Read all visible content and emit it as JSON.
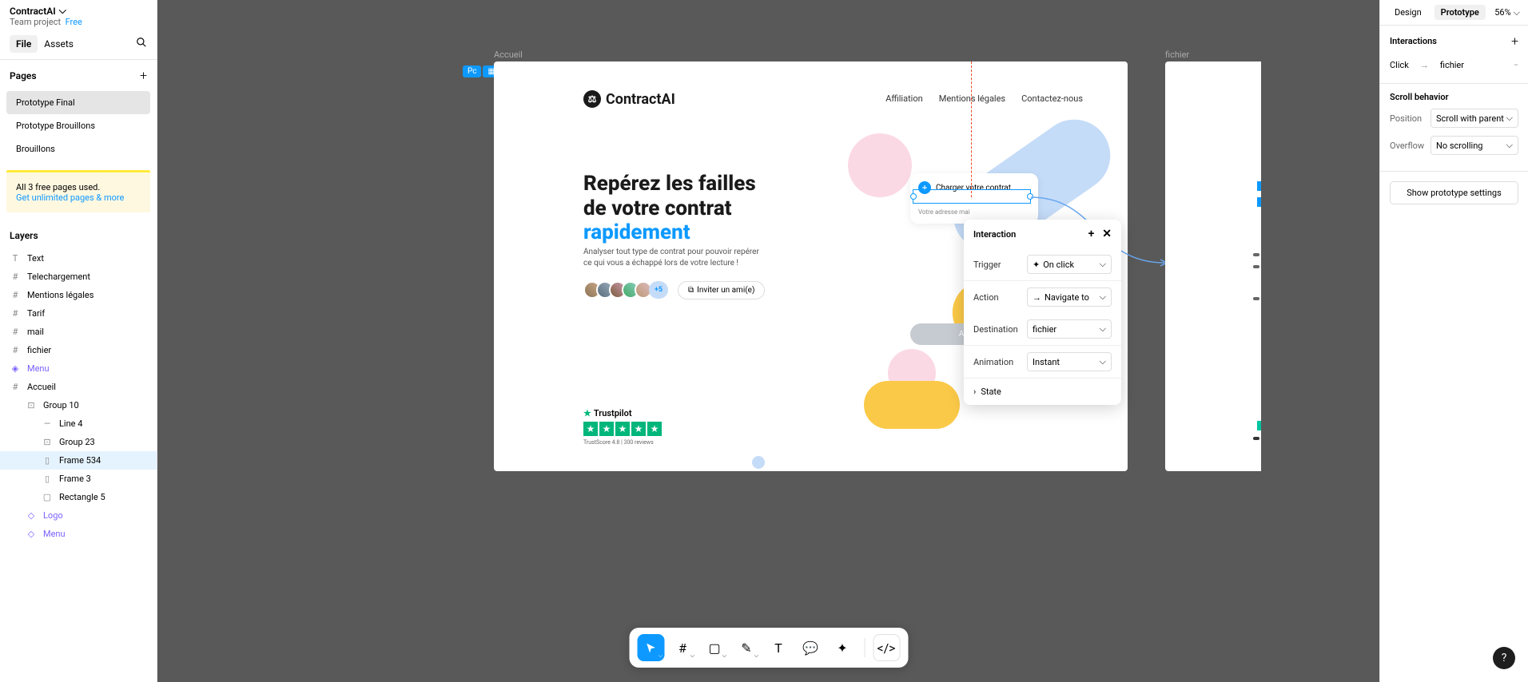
{
  "project": {
    "name": "ContractAI",
    "subtitle": "Team project",
    "plan": "Free"
  },
  "left_tabs": {
    "file": "File",
    "assets": "Assets"
  },
  "pages_header": "Pages",
  "pages": [
    {
      "name": "Prototype Final",
      "selected": true
    },
    {
      "name": "Prototype Brouillons",
      "selected": false
    },
    {
      "name": "Brouillons",
      "selected": false
    }
  ],
  "pages_notice": {
    "line1": "All 3 free pages used.",
    "link": "Get unlimited pages & more"
  },
  "layers_header": "Layers",
  "layers": [
    {
      "icon": "T",
      "name": "Text"
    },
    {
      "icon": "#",
      "name": "Telechargement"
    },
    {
      "icon": "#",
      "name": "Mentions légales"
    },
    {
      "icon": "#",
      "name": "Tarif"
    },
    {
      "icon": "#",
      "name": "mail"
    },
    {
      "icon": "#",
      "name": "fichier"
    },
    {
      "icon": "◈",
      "name": "Menu",
      "purple": true
    },
    {
      "icon": "#",
      "name": "Accueil"
    },
    {
      "icon": "⊡",
      "name": "Group 10",
      "indent": 1
    },
    {
      "icon": "—",
      "name": "Line 4",
      "indent": 2
    },
    {
      "icon": "⊡",
      "name": "Group 23",
      "indent": 2
    },
    {
      "icon": "▯",
      "name": "Frame 534",
      "indent": 2,
      "selected": true
    },
    {
      "icon": "▯",
      "name": "Frame 3",
      "indent": 2
    },
    {
      "icon": "▢",
      "name": "Rectangle 5",
      "indent": 2
    },
    {
      "icon": "◇",
      "name": "Logo",
      "indent": 1,
      "purple": true
    },
    {
      "icon": "◇",
      "name": "Menu",
      "indent": 1,
      "purple": true
    }
  ],
  "canvas": {
    "accueil_label": "Accueil",
    "fichier_label": "fichier",
    "badge": "Pc",
    "logo": "ContractAI",
    "nav": {
      "affiliation": "Affiliation",
      "mentions": "Mentions légales",
      "contact": "Contactez-nous"
    },
    "hero": {
      "l1": "Repérez les failles",
      "l2": "de votre contrat",
      "l3": "rapidement"
    },
    "sub": "Analyser tout type de contrat pour pouvoir repérer ce qui vous a échappé lors de votre lecture !",
    "avatars_more": "+5",
    "invite": "Inviter un ami(e)",
    "upload_btn": "Charger votre contrat",
    "upload_label": "Votre adresse mai",
    "analyze": "Analyser",
    "trustpilot": {
      "name": "Trustpilot",
      "score": "TrustScore 4.8 | 300 reviews"
    }
  },
  "popover": {
    "title": "Interaction",
    "trigger_label": "Trigger",
    "trigger": "On click",
    "action_label": "Action",
    "action": "Navigate to",
    "destination_label": "Destination",
    "destination": "fichier",
    "animation_label": "Animation",
    "animation": "Instant",
    "state": "State"
  },
  "right": {
    "tab_design": "Design",
    "tab_prototype": "Prototype",
    "zoom": "56%",
    "interactions_h": "Interactions",
    "interaction": {
      "trigger": "Click",
      "dest": "fichier"
    },
    "scroll_h": "Scroll behavior",
    "position_label": "Position",
    "position": "Scroll with parent",
    "overflow_label": "Overflow",
    "overflow": "No scrolling",
    "proto_settings": "Show prototype settings"
  }
}
